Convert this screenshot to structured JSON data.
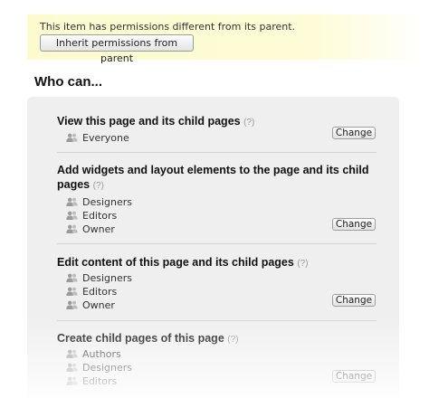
{
  "notice": {
    "message": "This item has permissions different from its parent.",
    "inherit_button": "Inherit permissions from parent"
  },
  "heading": "Who can...",
  "help_marker": "(?)",
  "change_label": "Change",
  "icon_name": "users-icon",
  "sections": [
    {
      "title": "View this page and its child pages",
      "members": [
        "Everyone"
      ]
    },
    {
      "title": "Add widgets and layout elements to the page and its child pages",
      "members": [
        "Designers",
        "Editors",
        "Owner"
      ]
    },
    {
      "title": "Edit content of this page and its child pages",
      "members": [
        "Designers",
        "Editors",
        "Owner"
      ]
    },
    {
      "title": "Create child pages of this page",
      "members": [
        "Authors",
        "Designers",
        "Editors"
      ]
    }
  ]
}
